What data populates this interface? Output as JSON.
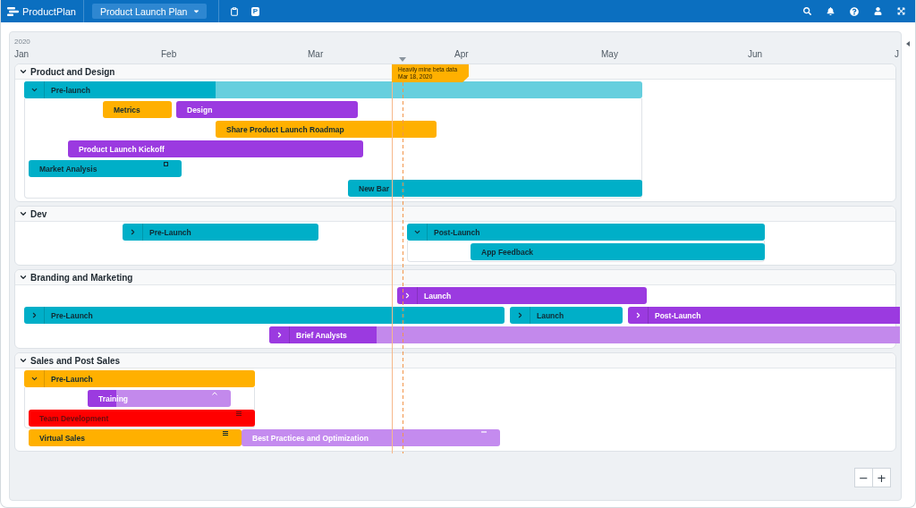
{
  "app": {
    "logo": "ProductPlan",
    "plan": "Product Launch Plan",
    "badge": "P"
  },
  "timeline": {
    "year": "2020",
    "months": [
      "Jan",
      "Feb",
      "Mar",
      "Apr",
      "May",
      "Jun",
      "J"
    ]
  },
  "milestone": {
    "title": "Heavily mine beta data",
    "date": "Mar 18, 2020"
  },
  "lanes": [
    {
      "title": "Product and Design",
      "expanded": true,
      "bars": [
        {
          "kind": "group",
          "label": "Pre-launch",
          "color": "#00afc8",
          "level": 0.31,
          "expanded": true,
          "children": [
            {
              "kind": "task",
              "label": "Metrics",
              "color": "#ffb000"
            },
            {
              "kind": "task",
              "label": "Design",
              "color": "#9b3ae0"
            },
            {
              "kind": "task",
              "label": "Share Product Launch Roadmap",
              "color": "#ffb000"
            },
            {
              "kind": "task",
              "label": "Product Launch Kickoff",
              "color": "#9b3ae0"
            },
            {
              "kind": "task",
              "label": "Market Analysis",
              "color": "#00afc8",
              "indicator": {
                "kind": "marker"
              }
            },
            {
              "kind": "task",
              "label": "New Bar",
              "color": "#00afc8"
            }
          ]
        }
      ]
    },
    {
      "title": "Dev",
      "expanded": true,
      "bars": [
        {
          "kind": "group",
          "label": "Pre-Launch",
          "color": "#00afc8",
          "expanded": false
        },
        {
          "kind": "group",
          "label": "Post-Launch",
          "color": "#00afc8",
          "expanded": true,
          "children": [
            {
              "kind": "task",
              "label": "App Feedback",
              "color": "#00afc8"
            }
          ]
        }
      ]
    },
    {
      "title": "Branding and Marketing",
      "expanded": true,
      "bars": [
        {
          "kind": "group",
          "label": "Launch",
          "color": "#9b3ae0",
          "expanded": false
        },
        {
          "kind": "group",
          "label": "Pre-Launch",
          "color": "#00afc8",
          "expanded": false
        },
        {
          "kind": "group",
          "label": "Launch",
          "color": "#00afc8",
          "expanded": false
        },
        {
          "kind": "group",
          "label": "Post-Launch",
          "color": "#9b3ae0",
          "expanded": false
        },
        {
          "kind": "group",
          "label": "Brief Analysts",
          "color": "#9b3ae0",
          "level": 0.17,
          "expanded": false
        }
      ]
    },
    {
      "title": "Sales and Post Sales",
      "expanded": true,
      "bars": [
        {
          "kind": "group",
          "label": "Pre-Launch",
          "color": "#ffb000",
          "expanded": true,
          "children": [
            {
              "kind": "task",
              "label": "Training",
              "color": "#9b3ae0",
              "level": 0.2,
              "indicator": {
                "kind": "caret"
              }
            },
            {
              "kind": "task",
              "label": "Team Development",
              "color": "#ff0000",
              "indicator": {
                "kind": "lines"
              }
            }
          ]
        },
        {
          "kind": "task",
          "label": "Virtual Sales",
          "color": "#ffb000",
          "indicator": {
            "kind": "lines"
          }
        },
        {
          "kind": "task",
          "label": "Best Practices and Optimization",
          "color": "#c48bef",
          "indicator": {
            "kind": "dash"
          }
        }
      ]
    }
  ],
  "zoom": [
    "−",
    "+"
  ]
}
